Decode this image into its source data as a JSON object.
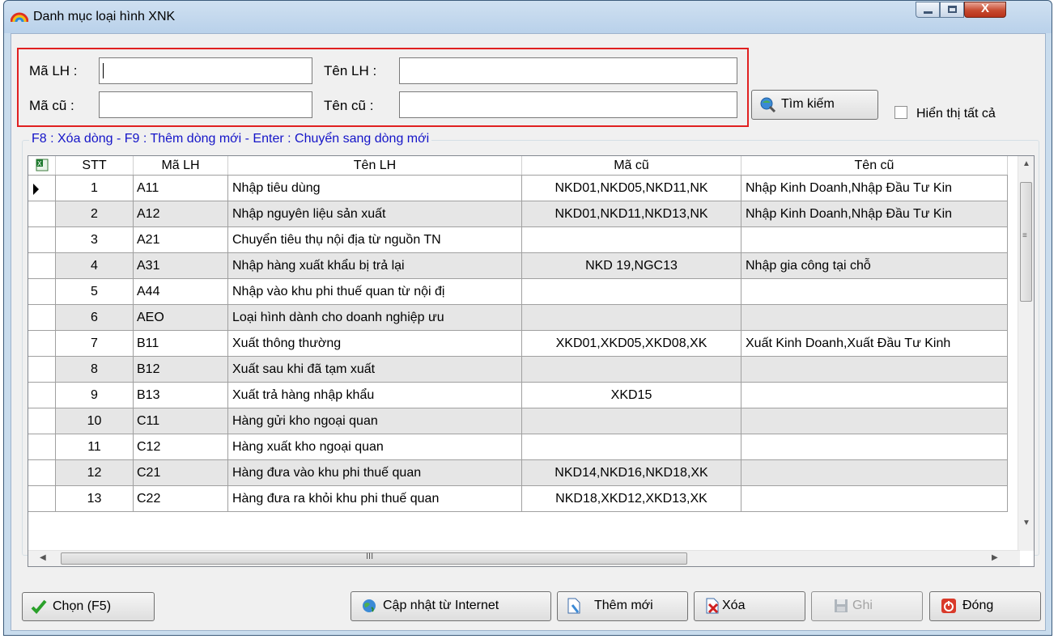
{
  "window": {
    "title": "Danh mục loại hình XNK",
    "close_glyph": "X"
  },
  "search": {
    "ma_lh_label": "Mã LH :",
    "ten_lh_label": "Tên LH :",
    "ma_cu_label": "Mã cũ :",
    "ten_cu_label": "Tên cũ :",
    "ma_lh_value": "",
    "ten_lh_value": "",
    "ma_cu_value": "",
    "ten_cu_value": "",
    "search_button": "Tìm kiếm",
    "show_all_label": "Hiển thị tất cả"
  },
  "hint": "F8 : Xóa dòng - F9 : Thêm dòng mới - Enter : Chuyển sang dòng mới",
  "grid": {
    "columns": [
      "STT",
      "Mã LH",
      "Tên LH",
      "Mã cũ",
      "Tên cũ"
    ],
    "rows": [
      [
        "1",
        "A11",
        "Nhập tiêu dùng",
        "NKD01,NKD05,NKD11,NK",
        "Nhập Kinh Doanh,Nhập Đầu Tư Kin"
      ],
      [
        "2",
        "A12",
        "Nhập nguyên liệu sản xuất",
        "NKD01,NKD11,NKD13,NK",
        "Nhập Kinh Doanh,Nhập Đầu Tư Kin"
      ],
      [
        "3",
        "A21",
        "Chuyển tiêu thụ nội địa từ nguồn TN",
        "",
        ""
      ],
      [
        "4",
        "A31",
        "Nhập hàng xuất khẩu bị trả lại",
        "NKD 19,NGC13",
        "Nhập gia công tại chỗ"
      ],
      [
        "5",
        "A44",
        "Nhập vào khu phi thuế quan từ nội đị",
        "",
        ""
      ],
      [
        "6",
        "AEO",
        "Loại hình dành cho doanh nghiệp ưu",
        "",
        ""
      ],
      [
        "7",
        "B11",
        "Xuất thông thường",
        "XKD01,XKD05,XKD08,XK",
        "Xuất Kinh Doanh,Xuất Đầu Tư Kinh"
      ],
      [
        "8",
        "B12",
        "Xuất sau khi đã tạm xuất",
        "",
        ""
      ],
      [
        "9",
        "B13",
        "Xuất trả hàng nhập khẩu",
        "XKD15",
        ""
      ],
      [
        "10",
        "C11",
        "Hàng gửi kho ngoại quan",
        "",
        ""
      ],
      [
        "11",
        "C12",
        "Hàng xuất kho ngoại quan",
        "",
        ""
      ],
      [
        "12",
        "C21",
        "Hàng đưa vào khu phi thuế quan",
        "NKD14,NKD16,NKD18,XK",
        ""
      ],
      [
        "13",
        "C22",
        "Hàng đưa ra khỏi khu phi thuế quan",
        "NKD18,XKD12,XKD13,XK",
        ""
      ]
    ],
    "hscroll_glyph": "III",
    "selected_row_index": 0
  },
  "buttons": {
    "chon": "Chọn (F5)",
    "cap_nhat": "Cập nhật từ Internet",
    "them_moi": "Thêm mới",
    "xoa": "Xóa",
    "ghi": "Ghi",
    "dong": "Đóng"
  },
  "colors": {
    "highlight_border": "#e02020",
    "hint_text": "#1414c8",
    "alt_row": "#e6e6e6"
  }
}
